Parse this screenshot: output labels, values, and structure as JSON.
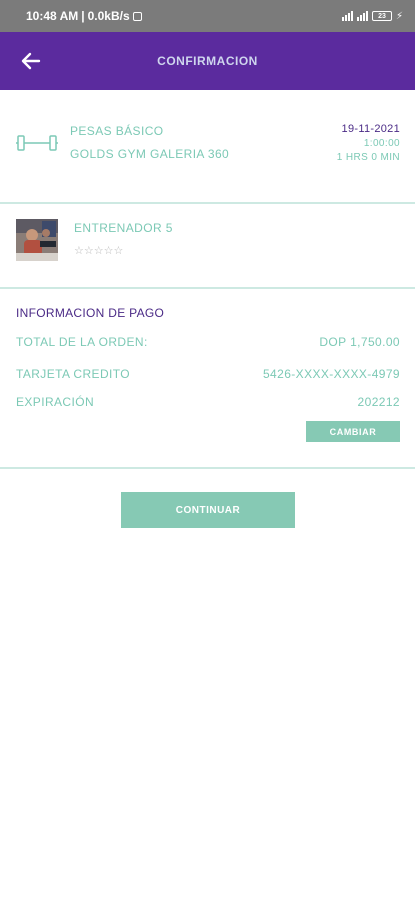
{
  "status_bar": {
    "time": "10:48 AM",
    "network_speed": "0.0kB/s",
    "battery": "23"
  },
  "header": {
    "title": "CONFIRMACION"
  },
  "class_info": {
    "name": "PESAS BÁSICO",
    "location": "GOLDS GYM GALERIA 360",
    "date": "19-11-2021",
    "time": "1:00:00",
    "duration": "1 HRS 0 MIN"
  },
  "trainer": {
    "name": "ENTRENADOR 5",
    "rating_stars": "☆☆☆☆☆"
  },
  "payment": {
    "section_title": "INFORMACION DE PAGO",
    "total_label": "TOTAL DE LA ORDEN:",
    "total_value": "DOP 1,750.00",
    "card_label": "TARJETA CREDITO",
    "card_value": "5426-XXXX-XXXX-4979",
    "expiration_label": "EXPIRACIÓN",
    "expiration_value": "202212",
    "change_button": "CAMBIAR"
  },
  "actions": {
    "continue_button": "CONTINUAR"
  },
  "colors": {
    "primary": "#5b2b9e",
    "accent": "#86c9b4",
    "accent_text": "#7cc9b5",
    "dark_text": "#4a2a86"
  }
}
